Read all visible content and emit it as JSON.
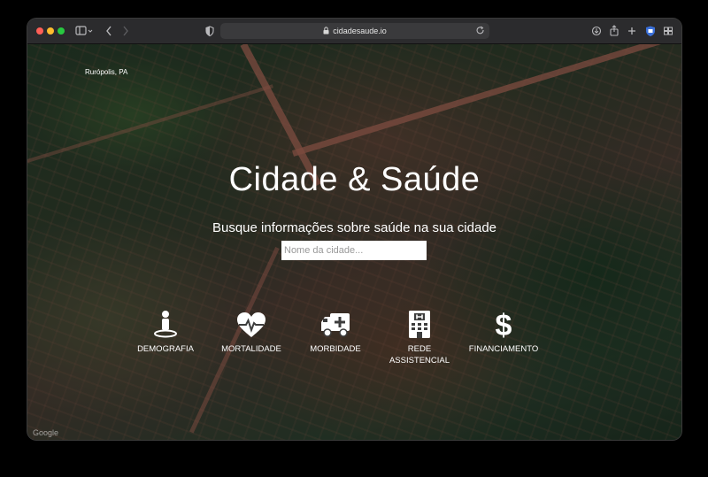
{
  "browser": {
    "url": "cidadesaude.io",
    "colors": {
      "toolbar": "#2b2b2d",
      "urlbar": "#3a3a3c"
    }
  },
  "page": {
    "location": "Rurópolis, PA",
    "title": "Cidade & Saúde",
    "subtitle": "Busque informações sobre saúde na sua cidade",
    "search": {
      "placeholder": "Nome da cidade...",
      "value": ""
    },
    "categories": [
      {
        "label": "DEMOGRAFIA",
        "icon": "person-pin-icon"
      },
      {
        "label": "MORTALIDADE",
        "icon": "heartbeat-icon"
      },
      {
        "label": "MORBIDADE",
        "icon": "ambulance-icon"
      },
      {
        "label": "REDE ASSISTENCIAL",
        "icon": "hospital-icon"
      },
      {
        "label": "FINANCIAMENTO",
        "icon": "dollar-icon"
      }
    ],
    "attribution": "Google"
  }
}
